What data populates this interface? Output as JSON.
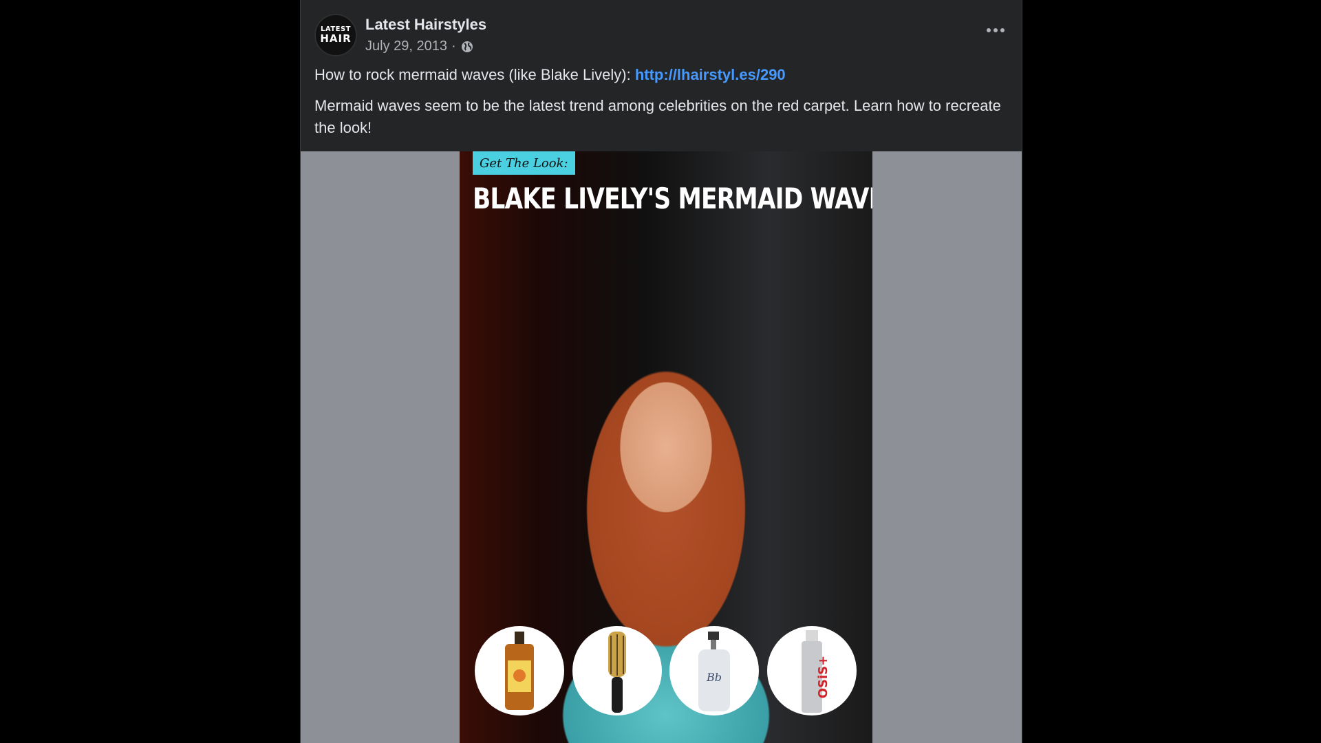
{
  "post": {
    "page_name": "Latest Hairstyles",
    "avatar": {
      "line1": "LATEST",
      "line2": "HAIR"
    },
    "date": "July 29, 2013",
    "separator": "·",
    "privacy_icon": "globe-icon",
    "more_icon": "more-options-icon",
    "text_prefix": "How to rock mermaid waves (like Blake Lively): ",
    "link": "http://lhairstyl.es/290",
    "description": "Mermaid waves seem to be the latest trend among celebrities on the red carpet. Learn how to recreate the look!"
  },
  "image": {
    "tag": "Get The Look:",
    "headline": "BLAKE LIVELY'S MERMAID WAVES",
    "products": [
      "oil-bottle",
      "round-brush",
      "spray-bottle",
      "hairspray-can"
    ]
  },
  "colors": {
    "background": "#000000",
    "card": "#242526",
    "text": "#e4e6eb",
    "secondary_text": "#b0b3b8",
    "link": "#4599ff",
    "media_bg": "#8d9096",
    "tag_bg": "#4ad0e0"
  }
}
